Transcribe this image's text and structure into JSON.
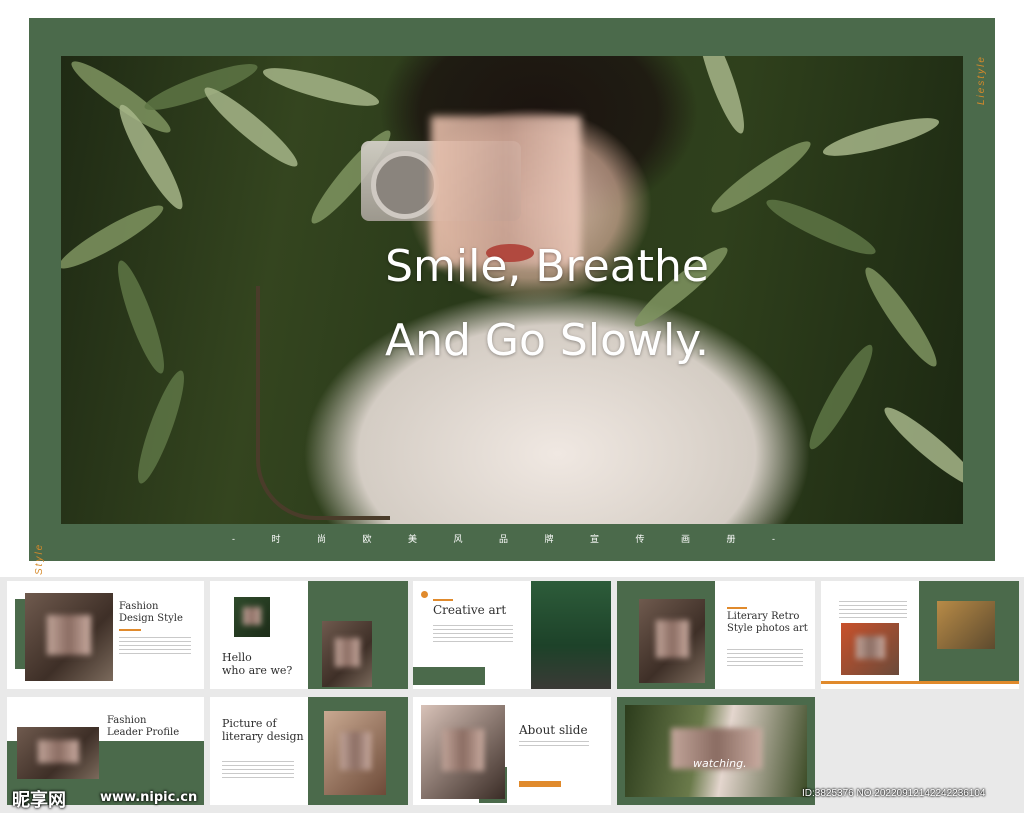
{
  "hero": {
    "title_line1": "Smile, Breathe",
    "title_line2": "And Go Slowly.",
    "chinese_caption": "- 时 尚 欧 美 风 品 牌 宣 传 画 册 -",
    "side_right": "Liestyle",
    "side_left": "Style"
  },
  "thumbnails": [
    {
      "title_line1": "Fashion",
      "title_line2": "Design Style"
    },
    {
      "title_line1": "Hello",
      "title_line2": "who are we?"
    },
    {
      "title": "Creative art"
    },
    {
      "title_line1": "Literary Retro",
      "title_line2": "Style photos art"
    },
    {
      "title_line1": "Fashion",
      "title_line2": "Leader Profile"
    },
    {
      "title_line1": "Picture of",
      "title_line2": "literary design"
    },
    {
      "title": "About slide"
    },
    {
      "overlay_text": "watching."
    }
  ],
  "watermark": {
    "logo": "昵享网",
    "url": "www.nipic.cn",
    "id": "ID:3825376 NO:20220912142242236104"
  },
  "colors": {
    "accent_green": "#4b6a4b",
    "accent_orange": "#e08a2c",
    "background": "#e9e9e9"
  }
}
